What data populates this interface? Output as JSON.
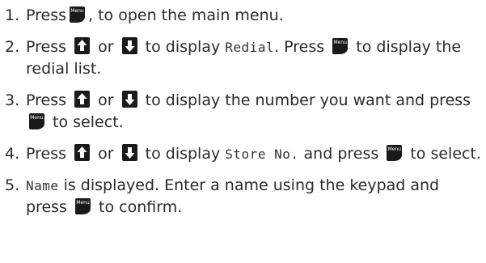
{
  "steps": [
    {
      "number": "1.",
      "parts": {
        "a": "Press",
        "b": ", to open the main menu."
      }
    },
    {
      "number": "2.",
      "parts": {
        "a": "Press",
        "b": "or",
        "c": "to display",
        "d": "Redial",
        "e": ". Press",
        "f": "to display the redial list."
      }
    },
    {
      "number": "3.",
      "parts": {
        "a": "Press",
        "b": "or",
        "c": "to display the number you want and press",
        "d": "to select."
      }
    },
    {
      "number": "4.",
      "parts": {
        "a": "Press",
        "b": "or",
        "c": "to display",
        "d": "Store No.",
        "e": "and press",
        "f": "to select."
      }
    },
    {
      "number": "5.",
      "parts": {
        "a": "Name",
        "b": "is displayed. Enter a name using the keypad and press",
        "c": "to confirm."
      }
    }
  ],
  "keys": {
    "menu_label": "Menu",
    "up_icon": "up-arrow-icon",
    "down_icon": "down-arrow-icon"
  },
  "colors": {
    "key_bg": "#1a1a1a",
    "text": "#2a2a2a"
  }
}
